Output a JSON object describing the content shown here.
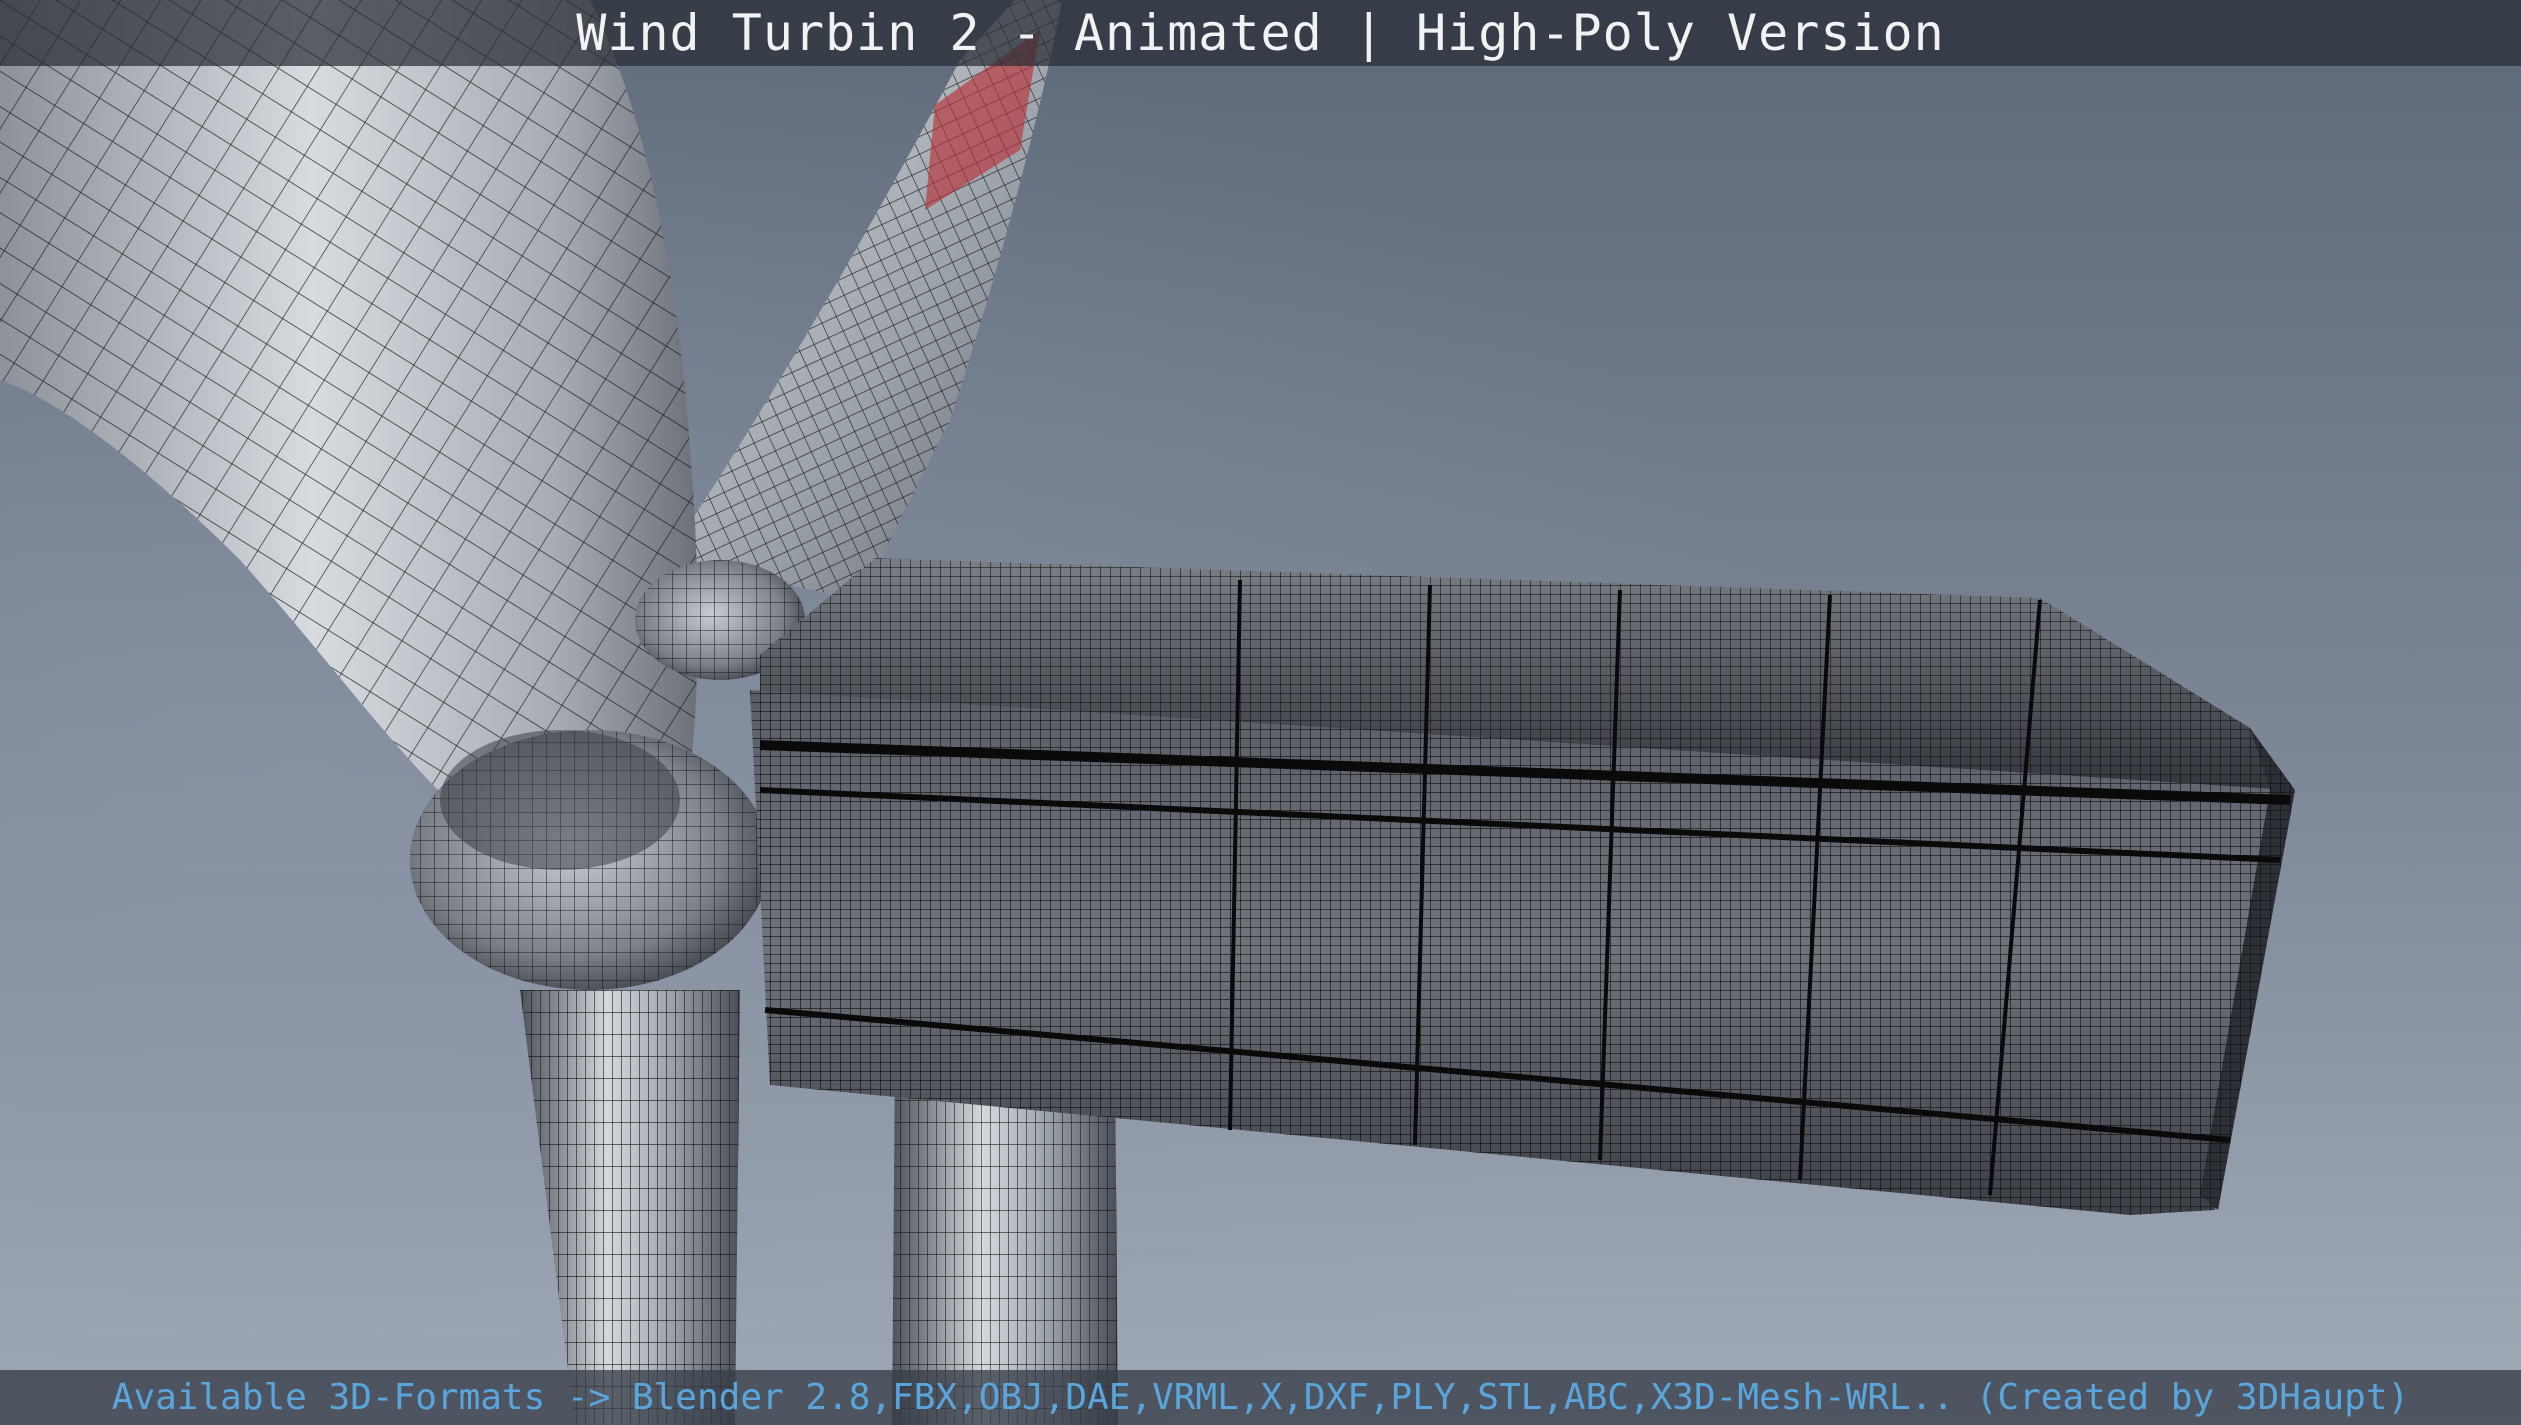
{
  "video": {
    "title": "Wind Turbin 2 - Animated | High-Poly Version",
    "footer": "Available 3D-Formats -> Blender 2.8,FBX,OBJ,DAE,VRML,X,DXF,PLY,STL,ABC,X3D-Mesh-WRL.. (Created by 3DHaupt)"
  },
  "colors": {
    "sky_top": "#5d6878",
    "sky_bottom": "#9ba5b3",
    "blade": "#c9cdd3",
    "blade_tip_red": "#b8323a",
    "nacelle": "#3a3d44",
    "wire": "#111111",
    "footer_text": "#5aa6dc",
    "title_text": "#f2f2f2"
  },
  "icons": {
    "scene": "wind-turbine-wireframe-render"
  }
}
